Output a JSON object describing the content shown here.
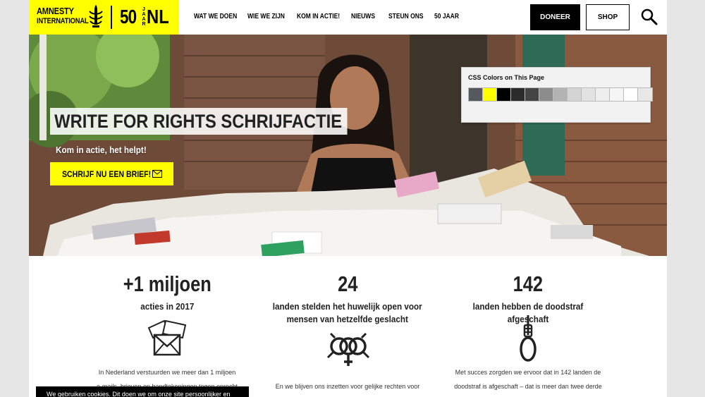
{
  "logo": {
    "line1": "AMNESTY",
    "line2": "INTERNATIONAL",
    "fifty": "50",
    "jaar": "JAAR",
    "nl": "NL",
    "brand_color": "#ffff00"
  },
  "nav": {
    "items": [
      "WAT WE DOEN",
      "WIE WE ZIJN",
      "KOM IN ACTIE!",
      "NIEUWS",
      "STEUN ONS",
      "50 JAAR"
    ]
  },
  "header": {
    "donate_label": "DONEER",
    "shop_label": "SHOP",
    "search_icon": "search-icon"
  },
  "hero": {
    "title": "WRITE FOR RIGHTS SCHRIJFACTIE",
    "subtitle": "Kom in actie, het helpt!",
    "cta_label": "SCHRIJF NU EEN BRIEF!",
    "cta_icon": "mail-icon"
  },
  "widget": {
    "title": "CSS Colors on This Page",
    "swatches": [
      "#55595e",
      "#ffff00",
      "#000000",
      "#2b2b2b",
      "#444444",
      "#8c8c8c",
      "#b3b3b3",
      "#d4d4d4",
      "#e2e2e2",
      "#eeeeee",
      "#f5f5f5",
      "#ffffff",
      "#e8e8e8"
    ]
  },
  "stats": [
    {
      "number": "+1 miljoen",
      "label_lines": [
        "acties in 2017"
      ],
      "icon": "envelopes-icon",
      "desc_lines": [
        "In Nederland verstuurden we meer dan 1 miljoen",
        "e-mails, brieven en handtekeningen tegen onrecht"
      ]
    },
    {
      "number": "24",
      "label_lines": [
        "landen stelden het huwelijk open voor",
        "mensen van hetzelfde geslacht"
      ],
      "icon": "gender-symbols-icon",
      "desc_lines": [
        "En we blijven ons inzetten voor gelijke rechten voor"
      ]
    },
    {
      "number": "142",
      "label_lines": [
        "landen hebben de doodstraf afgeschaft"
      ],
      "icon": "noose-icon",
      "desc_lines": [
        "Met succes zorgden we ervoor dat in 142 landen de",
        "doodstraf is afgeschaft – dat is meer dan twee derde"
      ]
    }
  ],
  "cookie": {
    "text": "We gebruiken cookies. Dit doen we om onze site persoonlijker en"
  }
}
